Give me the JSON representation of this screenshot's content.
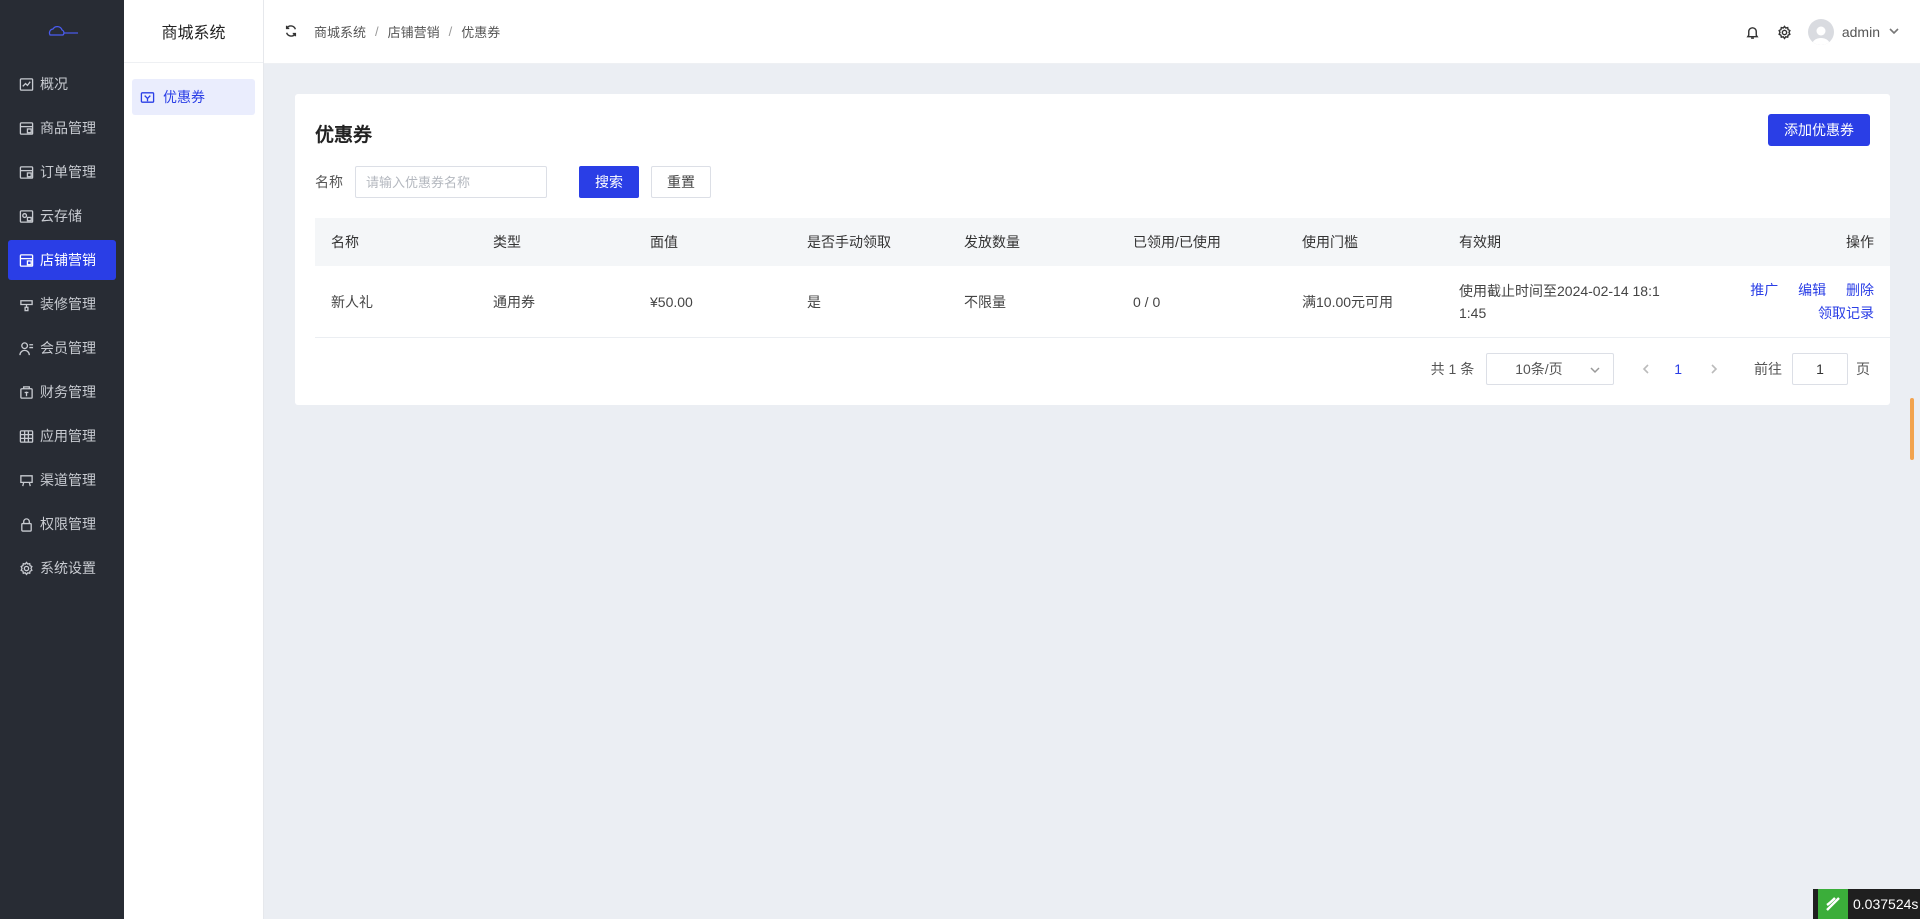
{
  "sidebar": {
    "items": [
      {
        "label": "概况",
        "icon": "chart-icon"
      },
      {
        "label": "商品管理",
        "icon": "goods-icon"
      },
      {
        "label": "订单管理",
        "icon": "order-icon"
      },
      {
        "label": "云存储",
        "icon": "cloud-storage-icon"
      },
      {
        "label": "店铺营销",
        "icon": "marketing-icon",
        "active": true
      },
      {
        "label": "装修管理",
        "icon": "decoration-icon"
      },
      {
        "label": "会员管理",
        "icon": "member-icon"
      },
      {
        "label": "财务管理",
        "icon": "finance-icon"
      },
      {
        "label": "应用管理",
        "icon": "apps-icon"
      },
      {
        "label": "渠道管理",
        "icon": "channel-icon"
      },
      {
        "label": "权限管理",
        "icon": "lock-icon"
      },
      {
        "label": "系统设置",
        "icon": "gear-icon"
      }
    ]
  },
  "submenu": {
    "title": "商城系统",
    "items": [
      {
        "label": "优惠券",
        "icon": "coupon-icon"
      }
    ]
  },
  "header": {
    "breadcrumb": [
      "商城系统",
      "店铺营销",
      "优惠券"
    ],
    "separator": "/",
    "user": "admin"
  },
  "page": {
    "title": "优惠券",
    "add_label": "添加优惠券",
    "filter": {
      "label": "名称",
      "placeholder": "请输入优惠券名称",
      "value": "",
      "search_label": "搜索",
      "reset_label": "重置"
    },
    "table": {
      "columns": [
        "名称",
        "类型",
        "面值",
        "是否手动领取",
        "发放数量",
        "已领用/已使用",
        "使用门槛",
        "有效期",
        "操作"
      ],
      "rows": [
        {
          "name": "新人礼",
          "type": "通用券",
          "value": "¥50.00",
          "manual": "是",
          "quantity": "不限量",
          "used": "0 / 0",
          "threshold": "满10.00元可用",
          "validity": "使用截止时间至2024-02-14 18:11:45",
          "actions": [
            "推广",
            "编辑",
            "删除",
            "领取记录"
          ]
        }
      ]
    },
    "pagination": {
      "total_text": "共 1 条",
      "page_size": "10条/页",
      "current_page": "1",
      "goto_label": "前往",
      "goto_value": "1",
      "page_unit": "页"
    }
  },
  "timer": {
    "text": "0.037524s"
  },
  "colors": {
    "accent": "#2a3ee6",
    "sidebar_bg": "#282c34",
    "page_bg": "#ebeef3",
    "timer_green": "#3bae3a"
  }
}
